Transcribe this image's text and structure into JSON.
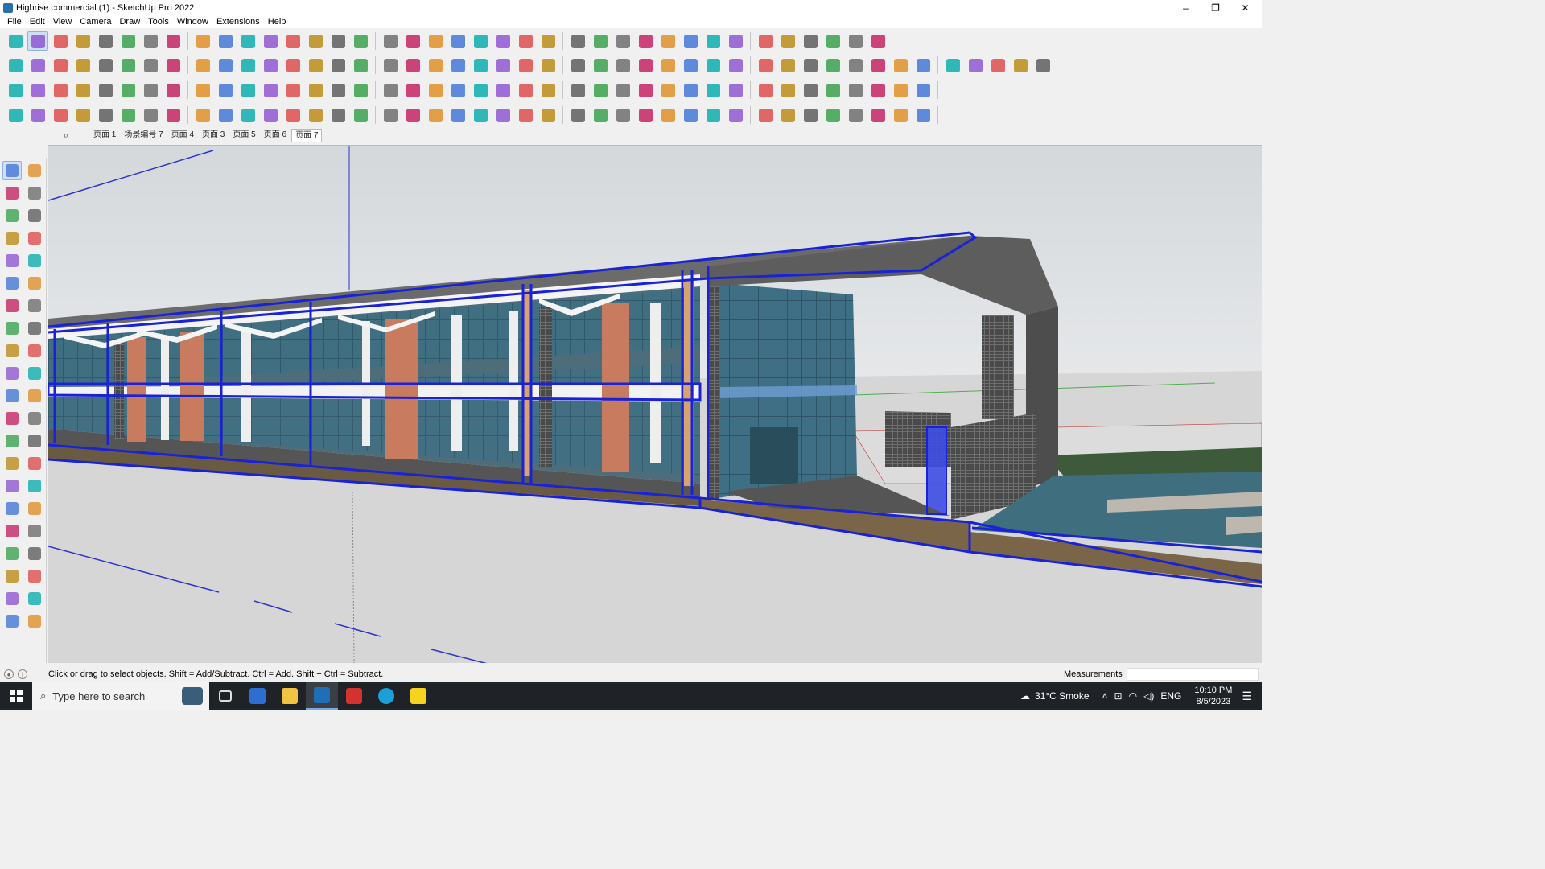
{
  "window": {
    "title": "Highrise commercial (1) - SketchUp Pro 2022",
    "controls": [
      "–",
      "❐",
      "✕"
    ]
  },
  "menu": [
    "File",
    "Edit",
    "View",
    "Camera",
    "Draw",
    "Tools",
    "Window",
    "Extensions",
    "Help"
  ],
  "toolbars": {
    "row1": [
      "zoom-window",
      "select",
      "select-dropdown",
      "eraser",
      "line",
      "line-dropdown",
      "lasso",
      "lasso-dropdown",
      "rectangle",
      "rectangle-dropdown",
      "push-pull",
      "follow-me",
      "move",
      "rotate",
      "scale",
      "tape",
      "text",
      "paint",
      "orbit",
      "pan",
      "zoom",
      "zoom-extents",
      "outliner",
      "sandbox",
      "layers",
      "styles",
      "user",
      "user-dropdown",
      "warehouse",
      "extension",
      "section",
      "flip",
      "mirror",
      "align",
      "explode",
      "undo",
      "redo",
      "solid"
    ],
    "row2": [
      "cube",
      "cube2",
      "cube3",
      "push1",
      "push2",
      "push3",
      "push4",
      "push5",
      "push6",
      "push7",
      "push8",
      "arc-tool",
      "slash1",
      "slash2",
      "slash3",
      "layer-green",
      "layer-green2",
      "house1",
      "house2",
      "house3",
      "house4",
      "house5",
      "house6",
      "fs-tool",
      "curve",
      "pen",
      "shape1",
      "shape2",
      "shape3",
      "shape4",
      "shape5",
      "shape6",
      "shape7",
      "shape8",
      "shape9",
      "shape10",
      "line-red",
      "eraser-pink",
      "brick1",
      "brick2",
      "face1",
      "face2",
      "face3",
      "face4",
      "face5"
    ],
    "row3": [
      "blue-layer",
      "blue2",
      "yellow",
      "green",
      "red",
      "gray",
      "undo-orange",
      "red-square",
      "table",
      "panel",
      "wood",
      "pipe",
      "hook",
      "node",
      "cross-red",
      "cross-green",
      "cross-blue",
      "cone",
      "tree",
      "tri",
      "magnet",
      "curve-knot",
      "knot",
      "move4",
      "box",
      "lasso2",
      "frame",
      "paint-stroke",
      "trans1",
      "trans2",
      "trans3",
      "gem",
      "chair",
      "window",
      "grid1",
      "grid2",
      "grid3",
      "dot",
      "arc2",
      "nodes"
    ],
    "row4": [
      "curve1",
      "curve2",
      "bucket",
      "scissors",
      "gear",
      "cut",
      "wire",
      "globe",
      "bend",
      "angle1",
      "angle2",
      "knife",
      "arc3",
      "gate",
      "tri-plane",
      "stairs",
      "sphere",
      "hand",
      "solid1",
      "solid2",
      "rail",
      "slope",
      "chev1",
      "chev2",
      "chev3",
      "stairs2",
      "stairs3",
      "stairs4",
      "stairs5",
      "stairs6",
      "hatch1",
      "hatch2",
      "hatch3",
      "hatch4",
      "grid-rail",
      "rad1",
      "rad2",
      "ramp",
      "fence",
      "shell"
    ]
  },
  "scene_tabs": [
    "页面 1",
    "场景编号 7",
    "页面 4",
    "页面 3",
    "页面 5",
    "页面 6",
    "页面 7"
  ],
  "active_scene": "页面 7",
  "status": {
    "hint": "Click or drag to select objects. Shift = Add/Subtract. Ctrl = Add. Shift + Ctrl = Subtract.",
    "measurements_label": "Measurements",
    "measurements_value": ""
  },
  "taskbar": {
    "search_placeholder": "Type here to search",
    "weather": "31°C  Smoke",
    "lang": "ENG",
    "time": "10:10 PM",
    "date": "8/5/2023"
  },
  "colors": {
    "selection": "#1a22d6",
    "ground": "#d9d9d9",
    "sky": "#dfe3e6",
    "glass": "#3c6b80",
    "pillar": "#c97b60",
    "roof": "#5a5a5a"
  }
}
